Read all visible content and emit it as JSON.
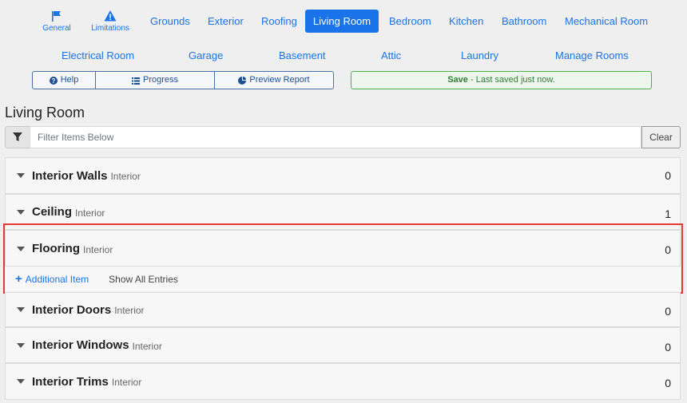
{
  "nav": {
    "icon_tabs": [
      {
        "label": "General",
        "icon": "flag-icon"
      },
      {
        "label": "Limitations",
        "icon": "warning-icon"
      }
    ],
    "row1": [
      "Grounds",
      "Exterior",
      "Roofing",
      "Living Room",
      "Bedroom",
      "Kitchen",
      "Bathroom",
      "Mechanical Room"
    ],
    "row2": [
      "Electrical Room",
      "Garage",
      "Basement",
      "Attic",
      "Laundry",
      "Manage Rooms"
    ],
    "active": "Living Room"
  },
  "toolbar": {
    "help_label": "Help",
    "progress_label": "Progress",
    "preview_label": "Preview Report"
  },
  "save": {
    "bold": "Save",
    "status": " - Last saved just now."
  },
  "page_title": "Living Room",
  "filter": {
    "placeholder": "Filter Items Below",
    "clear_label": "Clear"
  },
  "items": [
    {
      "name": "Interior Walls",
      "category": "Interior",
      "count": "0"
    },
    {
      "name": "Ceiling",
      "category": "Interior",
      "count": "1"
    },
    {
      "name": "Flooring",
      "category": "Interior",
      "count": "0"
    },
    {
      "name": "Interior Doors",
      "category": "Interior",
      "count": "0"
    },
    {
      "name": "Interior Windows",
      "category": "Interior",
      "count": "0"
    },
    {
      "name": "Interior Trims",
      "category": "Interior",
      "count": "0"
    }
  ],
  "expanded_actions": {
    "add_label": "Additional Item",
    "show_label": "Show All Entries"
  },
  "colors": {
    "accent": "#1a73e8",
    "highlight": "#e53935",
    "save_green": "#2e7d32"
  }
}
